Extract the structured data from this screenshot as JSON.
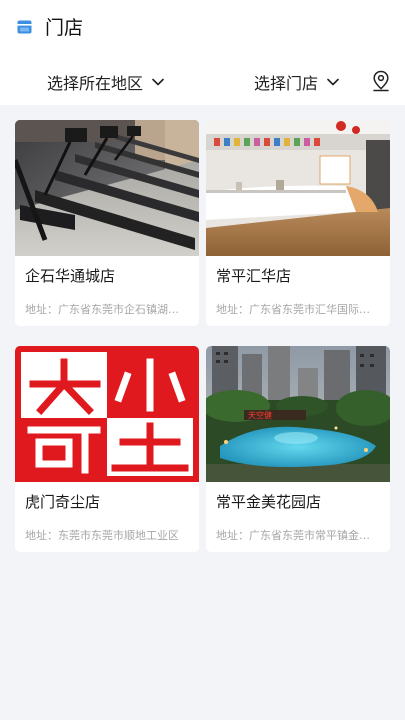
{
  "header": {
    "title": "门店",
    "icon": "store-icon"
  },
  "filters": {
    "region_label": "选择所在地区",
    "store_label": "选择门店"
  },
  "stores": [
    {
      "name": "企石华通城店",
      "address": "地址：广东省东莞市企石镇湖…",
      "image": "gym-treadmills-photo"
    },
    {
      "name": "常平汇华店",
      "address": "地址：广东省东莞市汇华国际…",
      "image": "gym-reception-photo"
    },
    {
      "name": "虎门奇尘店",
      "address": "地址：东莞市东莞市顺地工业区",
      "image": "red-seal-logo"
    },
    {
      "name": "常平金美花园店",
      "address": "地址：广东省东莞市常平镇金…",
      "image": "residential-pool-photo"
    }
  ],
  "colors": {
    "background": "#f3f4f8",
    "card": "#ffffff",
    "accent_icon": "#3d8fe0",
    "seal_red": "#e0191e"
  }
}
